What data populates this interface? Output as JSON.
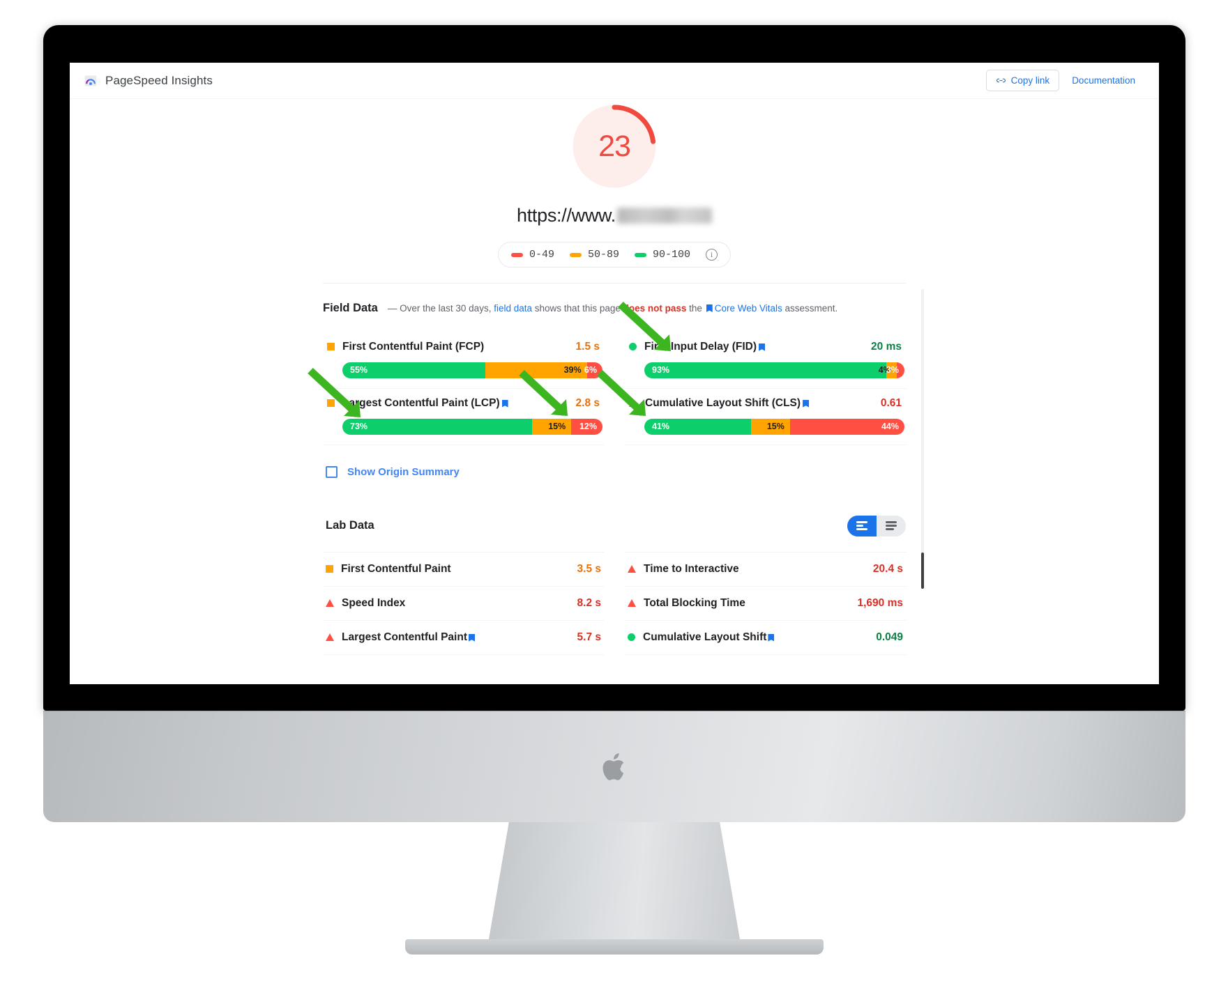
{
  "app": {
    "brand_name": "PageSpeed Insights",
    "brand_icon": "pagespeed-logo-icon",
    "copy_link_label": "Copy link",
    "copy_link_icon": "link-icon",
    "documentation_label": "Documentation"
  },
  "score": {
    "value": "23",
    "color": "#f0493e",
    "url_prefix": "https://www.",
    "url_blurred": true
  },
  "legend": {
    "items": [
      {
        "label": "0-49",
        "color": "#ff4e42"
      },
      {
        "label": "50-89",
        "color": "#ffa400"
      },
      {
        "label": "90-100",
        "color": "#0cce6b"
      }
    ],
    "info_icon": "info-icon",
    "info_glyph": "i"
  },
  "field_data": {
    "title": "Field Data",
    "desc_dash": "—",
    "desc_part1": "Over the last 30 days,",
    "desc_link1": "field data",
    "desc_part2": "shows that this page",
    "desc_fail": "does not pass",
    "desc_part3": "the",
    "desc_link2": "Core Web Vitals",
    "desc_part4": "assessment.",
    "origin_summary_label": "Show Origin Summary",
    "metrics": [
      {
        "name": "First Contentful Paint (FCP)",
        "value": "1.5 s",
        "status": "average",
        "icon": "square-orange-icon",
        "value_color": "#e8710a",
        "core_web_vital": false,
        "distribution": [
          {
            "label": "55%",
            "pct": 55,
            "band": "good"
          },
          {
            "label": "39%",
            "pct": 39,
            "band": "average"
          },
          {
            "label": "6%",
            "pct": 6,
            "band": "poor"
          }
        ]
      },
      {
        "name": "First Input Delay (FID)",
        "value": "20 ms",
        "status": "good",
        "icon": "circle-green-icon",
        "value_color": "#0b8043",
        "core_web_vital": true,
        "distribution": [
          {
            "label": "93%",
            "pct": 93,
            "band": "good"
          },
          {
            "label": "4%",
            "pct": 4,
            "band": "average"
          },
          {
            "label": "3%",
            "pct": 3,
            "band": "poor"
          }
        ]
      },
      {
        "name": "Largest Contentful Paint (LCP)",
        "value": "2.8 s",
        "status": "average",
        "icon": "square-orange-icon",
        "value_color": "#e8710a",
        "core_web_vital": true,
        "distribution": [
          {
            "label": "73%",
            "pct": 73,
            "band": "good"
          },
          {
            "label": "15%",
            "pct": 15,
            "band": "average"
          },
          {
            "label": "12%",
            "pct": 12,
            "band": "poor"
          }
        ]
      },
      {
        "name": "Cumulative Layout Shift (CLS)",
        "value": "0.61",
        "status": "poor",
        "icon": "triangle-red-icon",
        "value_color": "#d93025",
        "core_web_vital": true,
        "distribution": [
          {
            "label": "41%",
            "pct": 41,
            "band": "good"
          },
          {
            "label": "15%",
            "pct": 15,
            "band": "average"
          },
          {
            "label": "44%",
            "pct": 44,
            "band": "poor"
          }
        ]
      }
    ]
  },
  "lab_data": {
    "title": "Lab Data",
    "view_toggle": {
      "active": "expanded-view",
      "options": [
        "expanded-view",
        "compact-view"
      ]
    },
    "metrics": [
      {
        "name": "First Contentful Paint",
        "value": "3.5 s",
        "icon": "square-orange-icon",
        "value_color": "#e8710a",
        "core_web_vital": false
      },
      {
        "name": "Time to Interactive",
        "value": "20.4 s",
        "icon": "triangle-red-icon",
        "value_color": "#d93025",
        "core_web_vital": false
      },
      {
        "name": "Speed Index",
        "value": "8.2 s",
        "icon": "triangle-red-icon",
        "value_color": "#d93025",
        "core_web_vital": false
      },
      {
        "name": "Total Blocking Time",
        "value": "1,690 ms",
        "icon": "triangle-red-icon",
        "value_color": "#d93025",
        "core_web_vital": false
      },
      {
        "name": "Largest Contentful Paint",
        "value": "5.7 s",
        "icon": "triangle-red-icon",
        "value_color": "#d93025",
        "core_web_vital": true
      },
      {
        "name": "Cumulative Layout Shift",
        "value": "0.049",
        "icon": "circle-green-icon",
        "value_color": "#0b8043",
        "core_web_vital": true
      }
    ]
  },
  "annotations": {
    "arrow_color": "#3cb521",
    "count": 4,
    "targets": [
      "First Input Delay (FID)",
      "Largest Contentful Paint (LCP)",
      "Cumulative Layout Shift (CLS)",
      "Core Web Vitals"
    ]
  },
  "device": {
    "type": "imac-mockup",
    "logo": "apple-logo-icon"
  }
}
